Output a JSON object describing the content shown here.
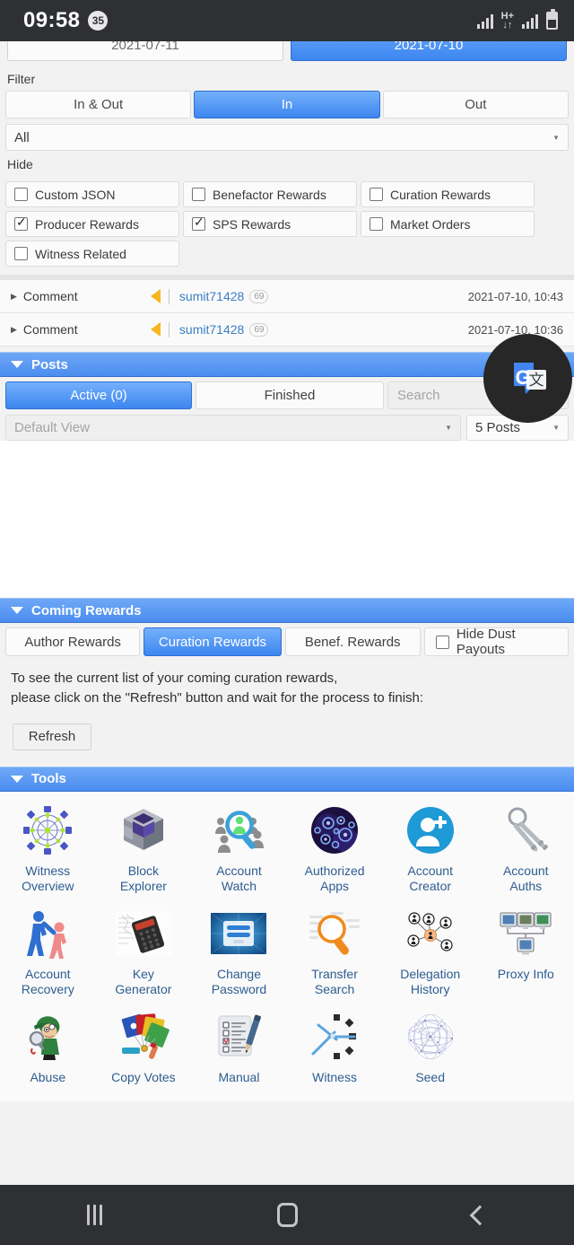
{
  "statusbar": {
    "clock": "09:58",
    "notification_count": "35",
    "signal_icon": "signal-bars-icon",
    "data_type": "H+",
    "data_arrows": "↓↑",
    "battery_icon": "battery-icon"
  },
  "date_row": {
    "left_date": "2021-07-11",
    "right_date": "2021-07-10"
  },
  "filter": {
    "label": "Filter",
    "segments": [
      {
        "label": "In & Out",
        "active": false
      },
      {
        "label": "In",
        "active": true
      },
      {
        "label": "Out",
        "active": false
      }
    ],
    "type_dropdown": "All"
  },
  "hide": {
    "label": "Hide",
    "items": [
      {
        "label": "Custom JSON",
        "checked": false
      },
      {
        "label": "Benefactor Rewards",
        "checked": false
      },
      {
        "label": "Curation Rewards",
        "checked": false
      },
      {
        "label": "Producer Rewards",
        "checked": true
      },
      {
        "label": "SPS Rewards",
        "checked": true
      },
      {
        "label": "Market Orders",
        "checked": false
      },
      {
        "label": "Witness Related",
        "checked": false
      }
    ]
  },
  "comments": [
    {
      "type": "Comment",
      "user": "sumit71428",
      "reputation": "69",
      "timestamp": "2021-07-10, 10:43"
    },
    {
      "type": "Comment",
      "user": "sumit71428",
      "reputation": "69",
      "timestamp": "2021-07-10, 10:36"
    }
  ],
  "posts": {
    "title": "Posts",
    "tabs": [
      {
        "label": "Active (0)",
        "active": true
      },
      {
        "label": "Finished",
        "active": false
      }
    ],
    "search_placeholder": "Search",
    "view_placeholder": "Default View",
    "count_label": "5 Posts"
  },
  "coming_rewards": {
    "title": "Coming Rewards",
    "tabs": [
      {
        "label": "Author Rewards",
        "active": false
      },
      {
        "label": "Curation Rewards",
        "active": true
      },
      {
        "label": "Benef. Rewards",
        "active": false
      }
    ],
    "hide_dust": {
      "label": "Hide Dust Payouts",
      "checked": false
    },
    "note_line1": "To see the current list of your coming curation rewards,",
    "note_line2": "please click on the \"Refresh\" button and wait for the process to finish:",
    "refresh_label": "Refresh"
  },
  "tools": {
    "title": "Tools",
    "items": [
      {
        "icon": "witness-overview-icon",
        "line1": "Witness",
        "line2": "Overview"
      },
      {
        "icon": "block-explorer-icon",
        "line1": "Block",
        "line2": "Explorer"
      },
      {
        "icon": "account-watch-icon",
        "line1": "Account",
        "line2": "Watch"
      },
      {
        "icon": "authorized-apps-icon",
        "line1": "Authorized",
        "line2": "Apps"
      },
      {
        "icon": "account-creator-icon",
        "line1": "Account",
        "line2": "Creator"
      },
      {
        "icon": "account-auths-icon",
        "line1": "Account",
        "line2": "Auths"
      },
      {
        "icon": "account-recovery-icon",
        "line1": "Account",
        "line2": "Recovery"
      },
      {
        "icon": "key-generator-icon",
        "line1": "Key",
        "line2": "Generator"
      },
      {
        "icon": "change-password-icon",
        "line1": "Change",
        "line2": "Password"
      },
      {
        "icon": "transfer-search-icon",
        "line1": "Transfer",
        "line2": "Search"
      },
      {
        "icon": "delegation-history-icon",
        "line1": "Delegation",
        "line2": "History"
      },
      {
        "icon": "proxy-info-icon",
        "line1": "Proxy Info",
        "line2": ""
      },
      {
        "icon": "abuse-icon",
        "line1": "Abuse",
        "line2": ""
      },
      {
        "icon": "copy-votes-icon",
        "line1": "Copy Votes",
        "line2": ""
      },
      {
        "icon": "manual-icon",
        "line1": "Manual",
        "line2": ""
      },
      {
        "icon": "witness-icon",
        "line1": "Witness",
        "line2": ""
      },
      {
        "icon": "seed-icon",
        "line1": "Seed",
        "line2": ""
      }
    ]
  },
  "floating": {
    "translate_icon": "google-translate-icon"
  },
  "navbar": {
    "recents_icon": "recents-icon",
    "home_icon": "home-icon",
    "back_icon": "back-icon"
  },
  "colors": {
    "accent_blue": "#4a8cef",
    "header_blue": "#6fa8f7",
    "link_blue": "#3a7ec4",
    "tool_label": "#2d5d90",
    "status_bg": "#2e3033",
    "arrow_orange": "#f5b620"
  }
}
